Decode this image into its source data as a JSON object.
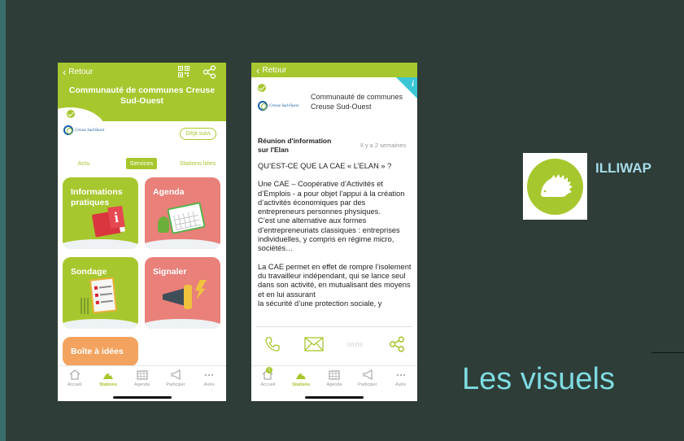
{
  "slide": {
    "brand_name": "ILLIWAP",
    "caption": "Les visuels",
    "colors": {
      "background": "#2e3d38",
      "accent_green": "#a7c72e",
      "caption_cyan": "#7fdbe0"
    }
  },
  "phone1": {
    "back_label": "Retour",
    "title": "Communauté de communes Creuse Sud-Ouest",
    "org_logo_text": "Creuse Sud-Ouest",
    "follow_button": "Déjà suivi",
    "tabs": [
      "Actu",
      "Services",
      "Stations liées"
    ],
    "tiles": [
      {
        "label": "Informations pratiques",
        "icon": "info-book-icon"
      },
      {
        "label": "Agenda",
        "icon": "calendar-icon"
      },
      {
        "label": "Sondage",
        "icon": "clipboard-icon"
      },
      {
        "label": "Signaler",
        "icon": "megaphone-icon"
      },
      {
        "label": "Boîte à idées",
        "icon": ""
      }
    ],
    "tabbar": [
      {
        "label": "Accueil",
        "icon": "home-icon"
      },
      {
        "label": "Stations",
        "icon": "stations-icon",
        "active": true
      },
      {
        "label": "Agenda",
        "icon": "calendar-icon"
      },
      {
        "label": "Participer",
        "icon": "megaphone-icon"
      },
      {
        "label": "Autre",
        "icon": "more-icon"
      }
    ]
  },
  "phone2": {
    "back_label": "Retour",
    "org_name": "Communauté de communes Creuse Sud-Ouest",
    "org_logo_text": "Creuse Sud-Ouest",
    "post_title": "Réunion d'information sur l'Elan",
    "post_time": "Il y a 2 semaines",
    "paragraphs": [
      "QU’EST-CE QUE LA CAE « L’ELAN » ?",
      "Une CAE – Coopérative d’Activités et d’Emplois - a pour objet l’appui à la création d’activités économiques par des entrepreneurs personnes physiques.\nC’est une alternative aux formes d’entrepreneuriats classiques : entreprises\nindividuelles, y compris en régime micro, sociétés…",
      "La CAE permet en effet de rompre l’isolement du travailleur indépendant, qui se lance seul dans son activité, en mutualisant des moyens et en lui assurant\nla sécurité d’une protection sociale, y"
    ],
    "actions": [
      {
        "name": "phone-icon"
      },
      {
        "name": "mail-icon"
      },
      {
        "name": "www-icon",
        "label": "www"
      },
      {
        "name": "share-icon"
      }
    ],
    "tabbar": [
      {
        "label": "Accueil",
        "icon": "home-icon",
        "badge": "1"
      },
      {
        "label": "Stations",
        "icon": "stations-icon",
        "active": true
      },
      {
        "label": "Agenda",
        "icon": "calendar-icon"
      },
      {
        "label": "Participer",
        "icon": "megaphone-icon"
      },
      {
        "label": "Autre",
        "icon": "more-icon"
      }
    ]
  }
}
